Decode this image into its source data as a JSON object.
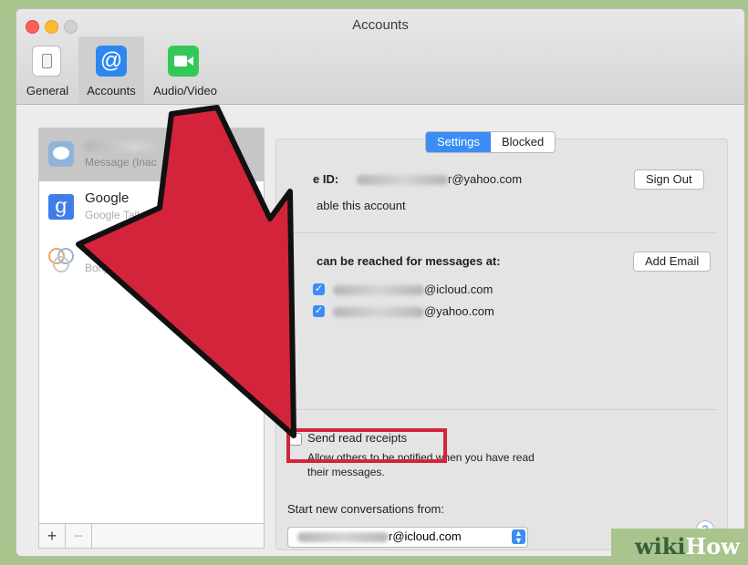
{
  "window": {
    "title": "Accounts"
  },
  "toolbar": {
    "items": [
      {
        "label": "General",
        "icon": "switch-icon"
      },
      {
        "label": "Accounts",
        "icon": "at-sign-icon"
      },
      {
        "label": "Audio/Video",
        "icon": "video-camera-icon"
      }
    ],
    "selected": "Accounts"
  },
  "sidebar": {
    "accounts": [
      {
        "name": "…oo...",
        "subtitle": "Message (Inac",
        "icon": "messages-bubble-icon",
        "selected": true
      },
      {
        "name": "Google",
        "subtitle": "Google Talk",
        "icon": "google-g-icon"
      },
      {
        "name": "Bonjo",
        "subtitle": "Bonjour (",
        "icon": "bonjour-icon"
      }
    ],
    "add_label": "+",
    "remove_label": "−"
  },
  "segmented": {
    "settings": "Settings",
    "blocked": "Blocked",
    "selected": "Settings"
  },
  "apple_id": {
    "label": "e ID:",
    "email_suffix": "r@yahoo.com",
    "enable_label": "able this account",
    "sign_out": "Sign Out"
  },
  "reach": {
    "heading": "can be reached for messages at:",
    "add_email": "Add Email",
    "addresses": [
      {
        "suffix": "@icloud.com",
        "checked": true
      },
      {
        "suffix": "@yahoo.com",
        "checked": true
      }
    ]
  },
  "read_receipts": {
    "label": "Send read receipts",
    "checked": false,
    "description_1": "Allow others to be notified when you have read",
    "description_2": "their messages."
  },
  "start_from": {
    "label": "Start new conversations from:",
    "value_suffix": "r@icloud.com"
  },
  "help": "?",
  "watermark": {
    "wiki": "wiki",
    "how": "How"
  },
  "colors": {
    "accent": "#3b8cf5",
    "arrow": "#d3243b",
    "frame": "#a9c48d"
  }
}
